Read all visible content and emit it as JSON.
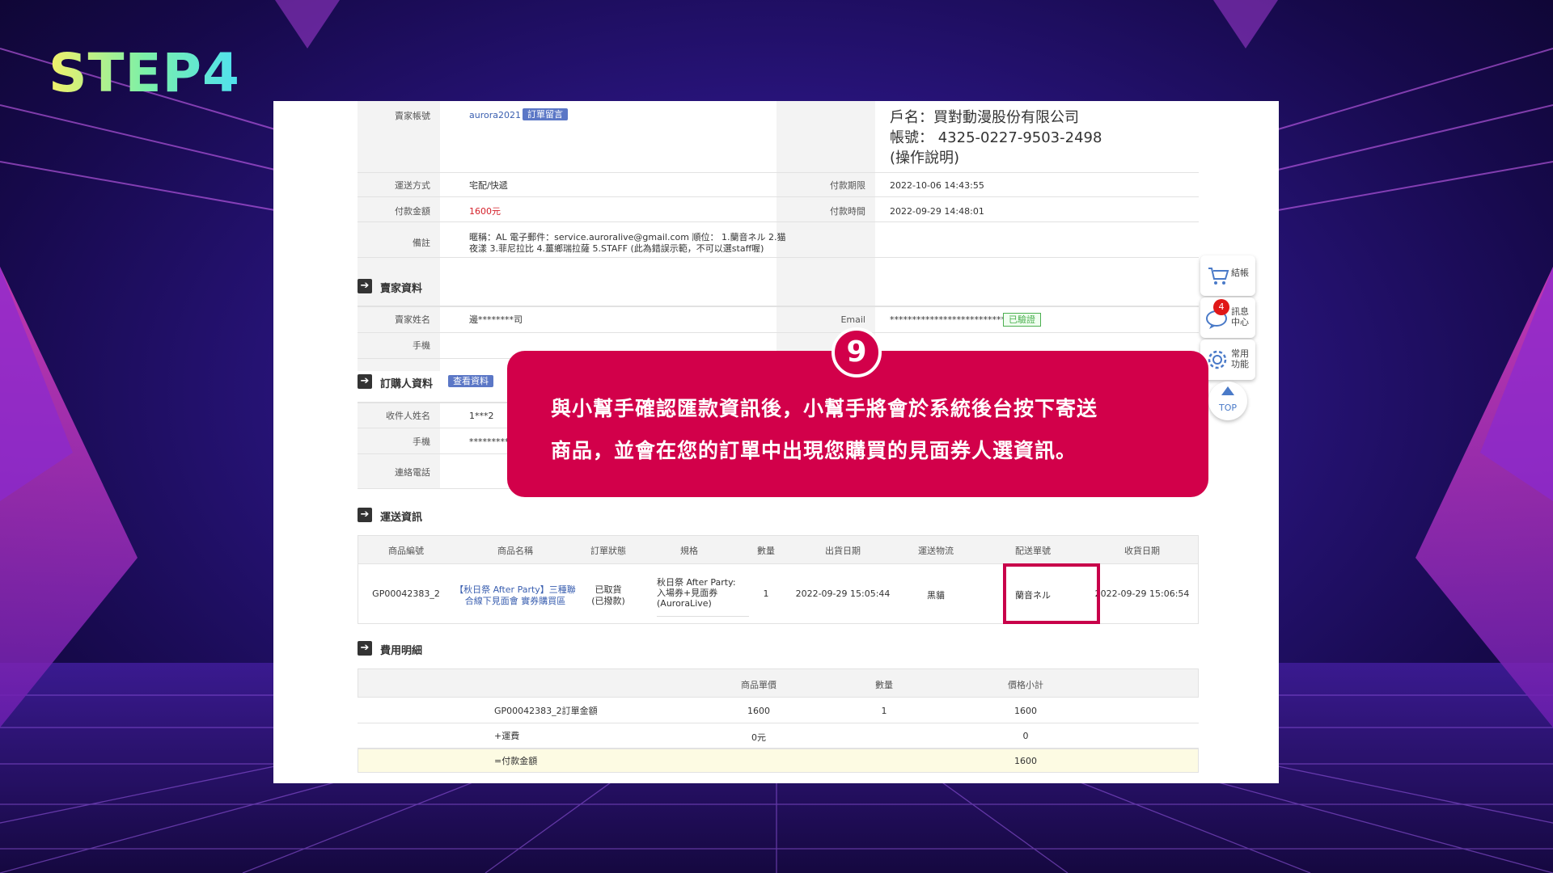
{
  "step_title": "STEP4",
  "seller": {
    "account_label": "賣家帳號",
    "account": "aurora2021",
    "message_badge": "訂單留言",
    "bank_name": "戶名：買對動漫股份有限公司",
    "bank_account": "帳號： 4325-0227-9503-2498",
    "bank_help": "(操作說明)",
    "shipping_label": "運送方式",
    "shipping": "宅配/快遞",
    "deadline_label": "付款期限",
    "deadline": "2022-10-06 14:43:55",
    "amount_label": "付款金額",
    "amount": "1600元",
    "paytime_label": "付款時間",
    "paytime": "2022-09-29 14:48:01",
    "note_label": "備註",
    "note_line1": "暱稱：AL 電子郵件：service.auroralive@gmail.com 順位： 1.蘭音ネル 2.猫",
    "note_line2": "夜漾 3.菲尼拉比 4.薑鄉瑞拉薩 5.STAFF (此為錯誤示範，不可以選staff喔)"
  },
  "seller_info": {
    "title": "賣家資料",
    "name_label": "賣家姓名",
    "name": "邊********司",
    "email_label": "Email",
    "email": "****************************",
    "verified": "已驗證",
    "phone_label": "手機"
  },
  "buyer": {
    "title": "訂購人資料",
    "view_badge": "查看資料",
    "recipient_label": "收件人姓名",
    "recipient": "1***2",
    "phone_label": "手機",
    "phone": "**********",
    "contact_label": "連絡電話"
  },
  "shipping_info": {
    "title": "運送資訊",
    "headers": [
      "商品編號",
      "商品名稱",
      "訂單狀態",
      "規格",
      "數量",
      "出貨日期",
      "運送物流",
      "配送單號",
      "收貨日期"
    ],
    "row": {
      "id": "GP00042383_2",
      "name_line1": "【秋日祭 After Party】三種聯",
      "name_line2": "合線下見面會 實券購買區",
      "status_line1": "已取貨",
      "status_line2": "(已撥款)",
      "spec_line1": "秋日祭 After Party:",
      "spec_line2": "入場券+見面券",
      "spec_line3": "(AuroraLive)",
      "qty": "1",
      "ship_date": "2022-09-29 15:05:44",
      "logistics": "黑貓",
      "tracking": "蘭音ネル",
      "recv_date": "2022-09-29 15:06:54"
    }
  },
  "fees": {
    "title": "費用明細",
    "headers": [
      "商品單價",
      "數量",
      "價格小計"
    ],
    "rows": [
      {
        "label": "GP00042383_2訂單金額",
        "price": "1600",
        "qty": "1",
        "subtotal": "1600"
      },
      {
        "label": "+運費",
        "price": "0元",
        "qty": "",
        "subtotal": "0"
      },
      {
        "label": "=付款金額",
        "price": "",
        "qty": "",
        "subtotal": "1600"
      }
    ]
  },
  "toolbar": {
    "cart": "結帳",
    "msg_line1": "訊息",
    "msg_line2": "中心",
    "msg_count": "4",
    "func_line1": "常用",
    "func_line2": "功能",
    "top": "TOP"
  },
  "callout": {
    "number": "9",
    "line1": "與小幫手確認匯款資訊後，小幫手將會於系統後台按下寄送",
    "line2": "商品，並會在您的訂單中出現您購買的見面券人選資訊。"
  },
  "colors": {
    "accent": "#d2004a",
    "highlight_box": "#c8004a",
    "badge": "#5b77c6"
  }
}
